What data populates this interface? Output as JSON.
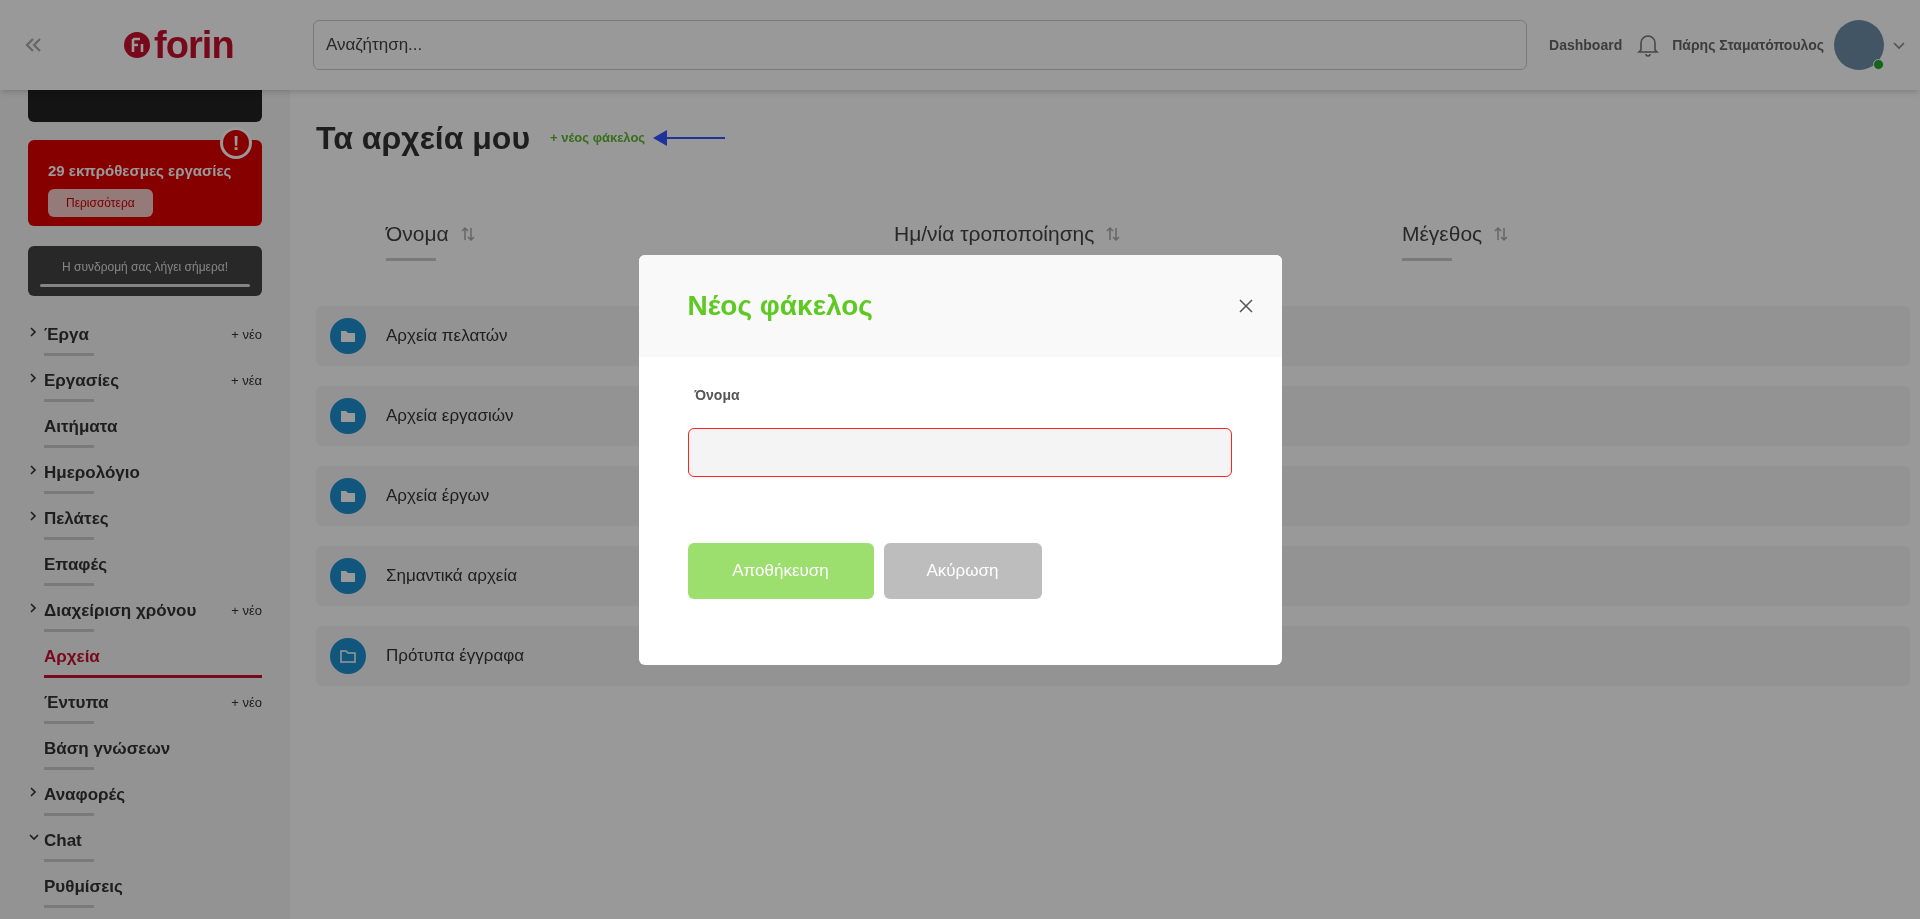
{
  "header": {
    "logo": "forin",
    "search": {
      "placeholder": "Αναζήτηση..."
    },
    "nav_link": "Dashboard",
    "user_name": "Πάρης Σταματόπουλος",
    "user_online": true
  },
  "sidebar": {
    "overdue_alert": {
      "text": "29 εκπρόθεσμες εργασίες",
      "badge": "!",
      "button": "Περισσότερα"
    },
    "subscription_notice": {
      "text": "Η συνδρομή σας λήγει σήμερα!"
    },
    "items": [
      {
        "label": "Έργα",
        "expanded": false,
        "selected": false,
        "add_label": "+ νέο"
      },
      {
        "label": "Εργασίες",
        "expanded": false,
        "selected": false,
        "add_label": "+ νέα"
      },
      {
        "label": "Αιτήματα",
        "selected": false
      },
      {
        "label": "Ημερολόγιο",
        "expanded": false,
        "selected": false
      },
      {
        "label": "Πελάτες",
        "expanded": false,
        "selected": false
      },
      {
        "label": "Επαφές",
        "selected": false
      },
      {
        "label": "Διαχείριση χρόνου",
        "expanded": false,
        "selected": false,
        "add_label": "+ νέο"
      },
      {
        "label": "Αρχεία",
        "selected": true
      },
      {
        "label": "Έντυπα",
        "selected": false,
        "add_label": "+ νέο"
      },
      {
        "label": "Βάση γνώσεων",
        "selected": false
      },
      {
        "label": "Αναφορές",
        "expanded": false,
        "selected": false
      },
      {
        "label": "Chat",
        "expanded": true,
        "selected": false
      },
      {
        "label": "Ρυθμίσεις",
        "selected": false
      }
    ]
  },
  "page": {
    "title": "Τα αρχεία μου",
    "new_folder_link": "+ νέος φάκελος",
    "columns": [
      {
        "label": "Όνομα"
      },
      {
        "label": "Ημ/νία τροποποίησης"
      },
      {
        "label": "Μέγεθος"
      }
    ],
    "folders": [
      {
        "name": "Αρχεία πελατών",
        "kind": "filled"
      },
      {
        "name": "Αρχεία εργασιών",
        "kind": "filled"
      },
      {
        "name": "Αρχεία έργων",
        "kind": "filled"
      },
      {
        "name": "Σημαντικά αρχεία",
        "kind": "filled"
      },
      {
        "name": "Πρότυπα έγγραφα",
        "kind": "outline"
      }
    ]
  },
  "modal": {
    "title": "Νέος φάκελος",
    "field_label": "Όνομα",
    "field": {
      "invalid": true
    },
    "buttons": [
      {
        "label": "Αποθήκευση",
        "kind": "primary"
      },
      {
        "label": "Ακύρωση",
        "kind": "secondary"
      }
    ]
  }
}
